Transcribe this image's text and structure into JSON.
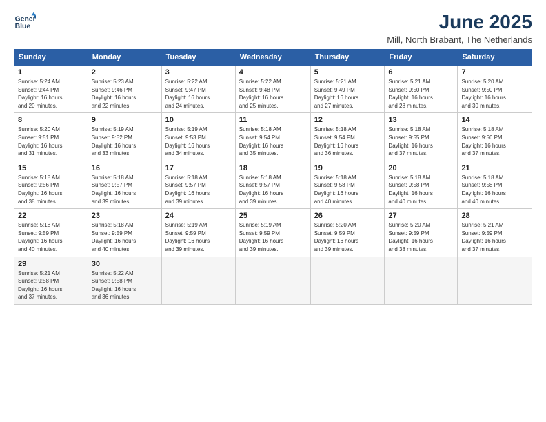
{
  "header": {
    "logo_line1": "General",
    "logo_line2": "Blue",
    "month": "June 2025",
    "location": "Mill, North Brabant, The Netherlands"
  },
  "weekdays": [
    "Sunday",
    "Monday",
    "Tuesday",
    "Wednesday",
    "Thursday",
    "Friday",
    "Saturday"
  ],
  "weeks": [
    [
      {
        "day": "1",
        "detail": "Sunrise: 5:24 AM\nSunset: 9:44 PM\nDaylight: 16 hours\nand 20 minutes."
      },
      {
        "day": "2",
        "detail": "Sunrise: 5:23 AM\nSunset: 9:46 PM\nDaylight: 16 hours\nand 22 minutes."
      },
      {
        "day": "3",
        "detail": "Sunrise: 5:22 AM\nSunset: 9:47 PM\nDaylight: 16 hours\nand 24 minutes."
      },
      {
        "day": "4",
        "detail": "Sunrise: 5:22 AM\nSunset: 9:48 PM\nDaylight: 16 hours\nand 25 minutes."
      },
      {
        "day": "5",
        "detail": "Sunrise: 5:21 AM\nSunset: 9:49 PM\nDaylight: 16 hours\nand 27 minutes."
      },
      {
        "day": "6",
        "detail": "Sunrise: 5:21 AM\nSunset: 9:50 PM\nDaylight: 16 hours\nand 28 minutes."
      },
      {
        "day": "7",
        "detail": "Sunrise: 5:20 AM\nSunset: 9:50 PM\nDaylight: 16 hours\nand 30 minutes."
      }
    ],
    [
      {
        "day": "8",
        "detail": "Sunrise: 5:20 AM\nSunset: 9:51 PM\nDaylight: 16 hours\nand 31 minutes."
      },
      {
        "day": "9",
        "detail": "Sunrise: 5:19 AM\nSunset: 9:52 PM\nDaylight: 16 hours\nand 33 minutes."
      },
      {
        "day": "10",
        "detail": "Sunrise: 5:19 AM\nSunset: 9:53 PM\nDaylight: 16 hours\nand 34 minutes."
      },
      {
        "day": "11",
        "detail": "Sunrise: 5:18 AM\nSunset: 9:54 PM\nDaylight: 16 hours\nand 35 minutes."
      },
      {
        "day": "12",
        "detail": "Sunrise: 5:18 AM\nSunset: 9:54 PM\nDaylight: 16 hours\nand 36 minutes."
      },
      {
        "day": "13",
        "detail": "Sunrise: 5:18 AM\nSunset: 9:55 PM\nDaylight: 16 hours\nand 37 minutes."
      },
      {
        "day": "14",
        "detail": "Sunrise: 5:18 AM\nSunset: 9:56 PM\nDaylight: 16 hours\nand 37 minutes."
      }
    ],
    [
      {
        "day": "15",
        "detail": "Sunrise: 5:18 AM\nSunset: 9:56 PM\nDaylight: 16 hours\nand 38 minutes."
      },
      {
        "day": "16",
        "detail": "Sunrise: 5:18 AM\nSunset: 9:57 PM\nDaylight: 16 hours\nand 39 minutes."
      },
      {
        "day": "17",
        "detail": "Sunrise: 5:18 AM\nSunset: 9:57 PM\nDaylight: 16 hours\nand 39 minutes."
      },
      {
        "day": "18",
        "detail": "Sunrise: 5:18 AM\nSunset: 9:57 PM\nDaylight: 16 hours\nand 39 minutes."
      },
      {
        "day": "19",
        "detail": "Sunrise: 5:18 AM\nSunset: 9:58 PM\nDaylight: 16 hours\nand 40 minutes."
      },
      {
        "day": "20",
        "detail": "Sunrise: 5:18 AM\nSunset: 9:58 PM\nDaylight: 16 hours\nand 40 minutes."
      },
      {
        "day": "21",
        "detail": "Sunrise: 5:18 AM\nSunset: 9:58 PM\nDaylight: 16 hours\nand 40 minutes."
      }
    ],
    [
      {
        "day": "22",
        "detail": "Sunrise: 5:18 AM\nSunset: 9:59 PM\nDaylight: 16 hours\nand 40 minutes."
      },
      {
        "day": "23",
        "detail": "Sunrise: 5:18 AM\nSunset: 9:59 PM\nDaylight: 16 hours\nand 40 minutes."
      },
      {
        "day": "24",
        "detail": "Sunrise: 5:19 AM\nSunset: 9:59 PM\nDaylight: 16 hours\nand 39 minutes."
      },
      {
        "day": "25",
        "detail": "Sunrise: 5:19 AM\nSunset: 9:59 PM\nDaylight: 16 hours\nand 39 minutes."
      },
      {
        "day": "26",
        "detail": "Sunrise: 5:20 AM\nSunset: 9:59 PM\nDaylight: 16 hours\nand 39 minutes."
      },
      {
        "day": "27",
        "detail": "Sunrise: 5:20 AM\nSunset: 9:59 PM\nDaylight: 16 hours\nand 38 minutes."
      },
      {
        "day": "28",
        "detail": "Sunrise: 5:21 AM\nSunset: 9:59 PM\nDaylight: 16 hours\nand 37 minutes."
      }
    ],
    [
      {
        "day": "29",
        "detail": "Sunrise: 5:21 AM\nSunset: 9:58 PM\nDaylight: 16 hours\nand 37 minutes."
      },
      {
        "day": "30",
        "detail": "Sunrise: 5:22 AM\nSunset: 9:58 PM\nDaylight: 16 hours\nand 36 minutes."
      },
      {
        "day": "",
        "detail": ""
      },
      {
        "day": "",
        "detail": ""
      },
      {
        "day": "",
        "detail": ""
      },
      {
        "day": "",
        "detail": ""
      },
      {
        "day": "",
        "detail": ""
      }
    ]
  ]
}
